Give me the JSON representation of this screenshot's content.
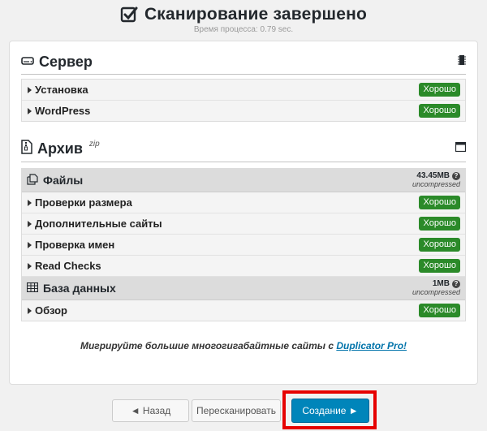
{
  "header": {
    "title": "Сканирование завершено",
    "subtitle": "Время процесса: 0.79 sec."
  },
  "server": {
    "title": "Сервер",
    "items": [
      {
        "label": "Установка",
        "status": "Хорошо"
      },
      {
        "label": "WordPress",
        "status": "Хорошо"
      }
    ]
  },
  "archive": {
    "title": "Архив",
    "sup": "zip",
    "files": {
      "title": "Файлы",
      "size": "43.45MB",
      "note": "uncompressed",
      "items": [
        {
          "label": "Проверки размера",
          "status": "Хорошо"
        },
        {
          "label": "Дополнительные сайты",
          "status": "Хорошо"
        },
        {
          "label": "Проверка имен",
          "status": "Хорошо"
        },
        {
          "label": "Read Checks",
          "status": "Хорошо"
        }
      ]
    },
    "database": {
      "title": "База данных",
      "size": "1MB",
      "note": "uncompressed",
      "items": [
        {
          "label": "Обзор",
          "status": "Хорошо"
        }
      ]
    }
  },
  "promo": {
    "text": "Мигрируйте большие многогигабайтные сайты с ",
    "link": "Duplicator Pro!"
  },
  "buttons": {
    "back": "◄ Назад",
    "rescan": "Пересканировать",
    "create": "Создание ►"
  },
  "colors": {
    "good": "#2b8a29",
    "primary": "#0085ba",
    "highlight": "#e60000"
  },
  "icons": [
    "checkbox-checked-icon",
    "server-icon",
    "microchip-icon",
    "file-archive-icon",
    "window-icon",
    "files-icon",
    "database-table-icon",
    "help-circle-icon"
  ]
}
